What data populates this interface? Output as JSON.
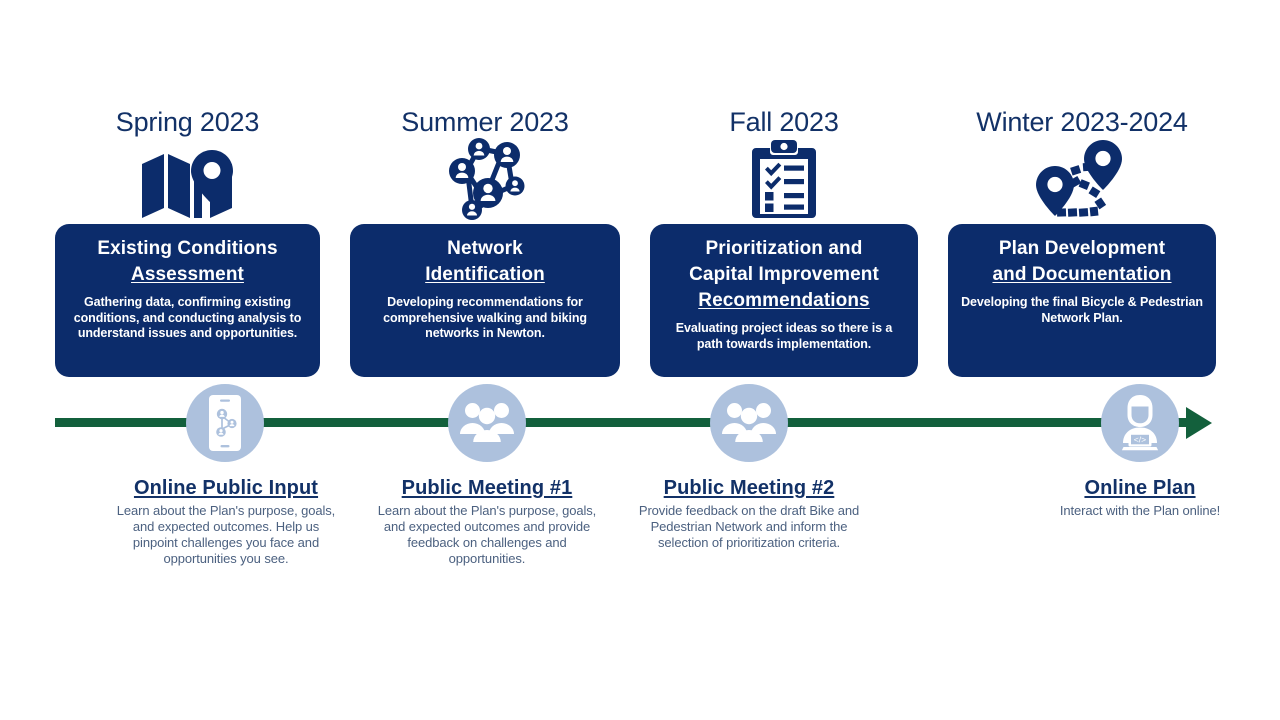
{
  "meta": {
    "colors": {
      "navy": "#0c2c6b",
      "heading_navy": "#123167",
      "green": "#13603c",
      "circle_blue": "#adc1dd",
      "body_slate": "#4c6180",
      "white": "#ffffff",
      "background": "#ffffff"
    }
  },
  "phases": [
    {
      "season": "Spring 2023",
      "icon": "folded-map-with-pin-icon",
      "title_line1": "Existing Conditions",
      "title_line2": "Assessment",
      "body": "Gathering data, confirming existing conditions, and conducting analysis to understand issues and opportunities."
    },
    {
      "season": "Summer 2023",
      "icon": "people-network-icon",
      "title_line1": "Network",
      "title_line2": "Identification",
      "body": "Developing recommendations for comprehensive walking and biking networks in Newton."
    },
    {
      "season": "Fall 2023",
      "icon": "clipboard-checklist-icon",
      "title_line1": "Prioritization and",
      "title_line1b": "Capital Improvement",
      "title_line2": "Recommendations",
      "body": "Evaluating project ideas so there is a path towards implementation."
    },
    {
      "season": "Winter 2023-2024",
      "icon": "route-map-pins-icon",
      "title_line1": "Plan Development",
      "title_line2": "and Documentation",
      "body": "Developing the final Bicycle & Pedestrian Network Plan."
    }
  ],
  "milestones": [
    {
      "icon": "mobile-phone-network-icon",
      "title": "Online Public Input",
      "body": "Learn about the Plan's purpose, goals, and expected outcomes. Help us pinpoint challenges you face and opportunities you see."
    },
    {
      "icon": "group-of-people-icon",
      "title": "Public Meeting #1",
      "body": "Learn about the Plan's purpose, goals, and expected outcomes and provide feedback on challenges and opportunities."
    },
    {
      "icon": "group-of-people-icon",
      "title": "Public Meeting #2",
      "body": "Provide feedback on the draft Bike and Pedestrian Network and inform the selection of prioritization criteria."
    },
    {
      "icon": "person-at-laptop-icon",
      "title": "Online Plan",
      "body": "Interact with the Plan online!"
    }
  ],
  "timeline": {
    "direction_label": "forward-arrow"
  }
}
